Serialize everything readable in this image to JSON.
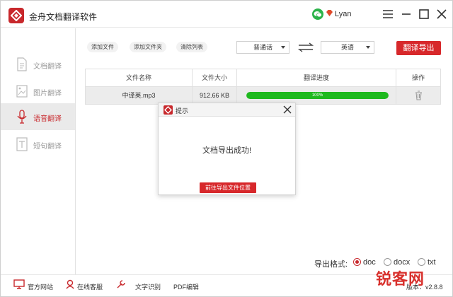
{
  "app": {
    "title": "金舟文档翻译软件",
    "user_name": "Lyan"
  },
  "sidebar": {
    "items": [
      {
        "label": "文档翻译",
        "icon": "document-icon",
        "active": false
      },
      {
        "label": "图片翻译",
        "icon": "image-icon",
        "active": false
      },
      {
        "label": "语音翻译",
        "icon": "microphone-icon",
        "active": true
      },
      {
        "label": "短句翻译",
        "icon": "text-icon",
        "active": false
      }
    ]
  },
  "toolbar": {
    "add_file": "添加文件",
    "add_folder": "添加文件夹",
    "clear_list": "清除列表",
    "source_lang": "普通话",
    "target_lang": "英语",
    "export_label": "翻译导出"
  },
  "table": {
    "headers": [
      "文件名称",
      "文件大小",
      "翻译进度",
      "操作"
    ],
    "rows": [
      {
        "name": "中译英.mp3",
        "size": "912.66 KB",
        "progress_text": "100%",
        "progress": 1.0
      }
    ]
  },
  "dialog": {
    "title": "提示",
    "message": "文档导出成功!",
    "button": "前往导出文件位置"
  },
  "export_format": {
    "label": "导出格式:",
    "options": [
      "doc",
      "docx",
      "txt"
    ],
    "selected": "doc"
  },
  "bottom": {
    "official_site": "官方网站",
    "online_service": "在线客服",
    "ocr": "文字识别",
    "pdf_edit": "PDF编辑",
    "version": "版本：v2.8.8"
  },
  "watermark": "锐客网",
  "colors": {
    "accent": "#d7282b",
    "progress": "#1fb91f"
  }
}
